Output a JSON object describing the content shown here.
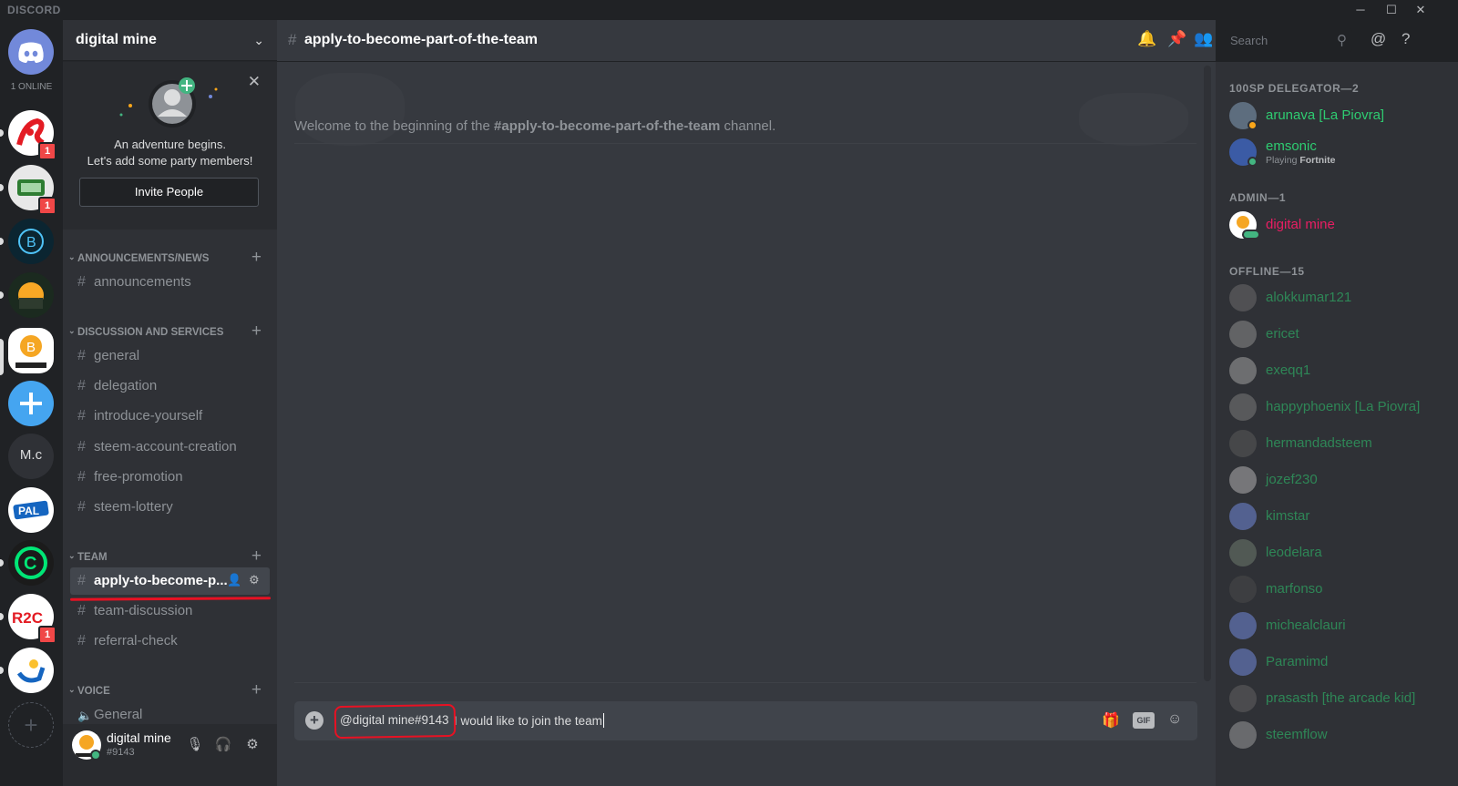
{
  "app": {
    "brand": "DISCORD",
    "online_count": "1 ONLINE"
  },
  "window_controls": {
    "minimize": "─",
    "maximize": "☐",
    "close": "✕"
  },
  "guilds": [
    {
      "badge": "1"
    },
    {
      "badge": "1"
    },
    {
      "badge": ""
    },
    {
      "badge": ""
    },
    {
      "badge": ""
    },
    {
      "label": "M.c"
    },
    {
      "badge": ""
    },
    {
      "badge": ""
    },
    {
      "badge": "1"
    },
    {
      "badge": ""
    }
  ],
  "server": {
    "name": "digital mine",
    "invite_text_1": "An adventure begins.",
    "invite_text_2": "Let's add some party members!",
    "invite_button": "Invite People"
  },
  "categories": [
    {
      "name": "ANNOUNCEMENTS/NEWS",
      "channels": [
        "announcements"
      ]
    },
    {
      "name": "DISCUSSION AND SERVICES",
      "channels": [
        "general",
        "delegation",
        "introduce-yourself",
        "steem-account-creation",
        "free-promotion",
        "steem-lottery"
      ]
    },
    {
      "name": "TEAM",
      "channels": [
        "apply-to-become-p...",
        "team-discussion",
        "referral-check"
      ]
    },
    {
      "name": "VOICE",
      "channels": [
        "General"
      ]
    }
  ],
  "user": {
    "name": "digital mine",
    "tag": "#9143"
  },
  "chat": {
    "channel": "apply-to-become-part-of-the-team",
    "welcome_prefix": "Welcome to the beginning of the ",
    "welcome_channel": "#apply-to-become-part-of-the-team",
    "welcome_suffix": " channel.",
    "search_placeholder": "Search",
    "composer_mention": "@digital mine#9143",
    "composer_text": " I would like to join the team",
    "gif_label": "GIF"
  },
  "member_groups": [
    {
      "title": "100SP DELEGATOR—2"
    },
    {
      "title": "ADMIN—1"
    },
    {
      "title": "OFFLINE—15"
    }
  ],
  "members": {
    "delegators": [
      {
        "name": "arunava [La Piovra]",
        "color": "#2ecc71"
      },
      {
        "name": "emsonic",
        "color": "#2ecc71",
        "activity_prefix": "Playing ",
        "activity_game": "Fortnite"
      }
    ],
    "admins": [
      {
        "name": "digital mine",
        "color": "#e91e63"
      }
    ],
    "offline": [
      "alokkumar121",
      "ericet",
      "exeqq1",
      "happyphoenix [La Piovra]",
      "hermandadsteem",
      "jozef230",
      "kimstar",
      "leodelara",
      "marfonso",
      "michealclauri",
      "Paramimd",
      "prasasth [the arcade kid]",
      "steemflow"
    ]
  },
  "colors": {
    "accent": "#7289da",
    "online": "#43b581",
    "idle": "#faa61a",
    "mention_badge": "#f04747",
    "annotation": "#e81123"
  }
}
